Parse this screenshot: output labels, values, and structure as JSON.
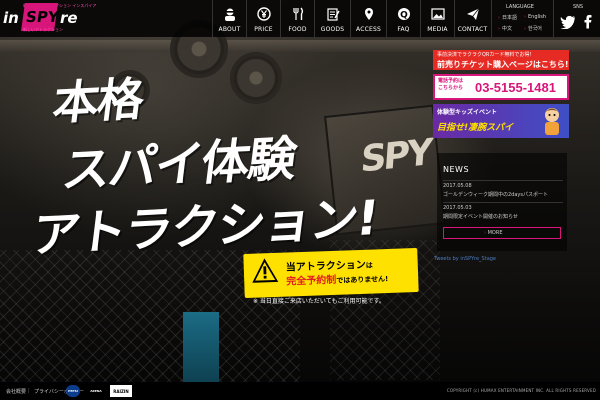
{
  "logo": {
    "tagline_top": "新宿スパイアトラクション インスパイア",
    "word_in": "in",
    "word_spy": "SPY",
    "word_re": "re",
    "tagline_bottom": "新しいアトラクション"
  },
  "nav": {
    "items": [
      {
        "label": "ABOUT",
        "icon": "spy-face-icon"
      },
      {
        "label": "PRICE",
        "icon": "yen-icon"
      },
      {
        "label": "FOOD",
        "icon": "fork-knife-icon"
      },
      {
        "label": "GOODS",
        "icon": "notepad-icon"
      },
      {
        "label": "ACCESS",
        "icon": "map-pin-icon"
      },
      {
        "label": "FAQ",
        "icon": "question-icon"
      },
      {
        "label": "MEDIA",
        "icon": "image-icon"
      },
      {
        "label": "CONTACT",
        "icon": "paper-plane-icon"
      }
    ],
    "language_title": "LANGUAGE",
    "languages": [
      "日本語",
      "English",
      "中文",
      "한국어"
    ],
    "sns_title": "SNS"
  },
  "banners": {
    "ticket_small": "事前決済でラクラクQRカード無料でお得！",
    "ticket_big": "前売りチケット購入ページはこちら!",
    "tel_small_1": "電話予約は",
    "tel_small_2": "こちらから",
    "tel_number": "03-5155-1481",
    "kids_small": "体験型キッズイベント",
    "kids_big": "目指せ!凄腕スパイ"
  },
  "news": {
    "heading": "NEWS",
    "items": [
      {
        "date": "2017.05.08",
        "text": "ゴールデンウィーク期間中の2daysパスポート"
      },
      {
        "date": "2017.05.03",
        "text": "期間限定イベント開催のお知らせ"
      }
    ],
    "more_label": "MORE",
    "tweets_label": "Tweets by inSPYre_Stage"
  },
  "hero": {
    "line1": "本格",
    "line2": "スパイ体験",
    "line3": "アトラクション!",
    "notice_line1_a": "当アトラクション",
    "notice_line1_b": "は",
    "notice_line2_red": "完全予約制",
    "notice_line2_b": "ではありません!",
    "sub_notice": "※ 当日直接ご来店いただいてもご利用可能です。"
  },
  "footer": {
    "link1": "会社概要",
    "link2": "プライバシーポリシー",
    "sponsors": [
      "PEPSI",
      "ARENA",
      "RAIZIN"
    ],
    "copyright": "COPYRIGHT (c) HUMAX ENTERTAINMENT INC. ALL RIGHTS RESERVED"
  },
  "colors": {
    "accent": "#d8157a",
    "notice": "#ffe100",
    "warn_red": "#e31c24"
  }
}
